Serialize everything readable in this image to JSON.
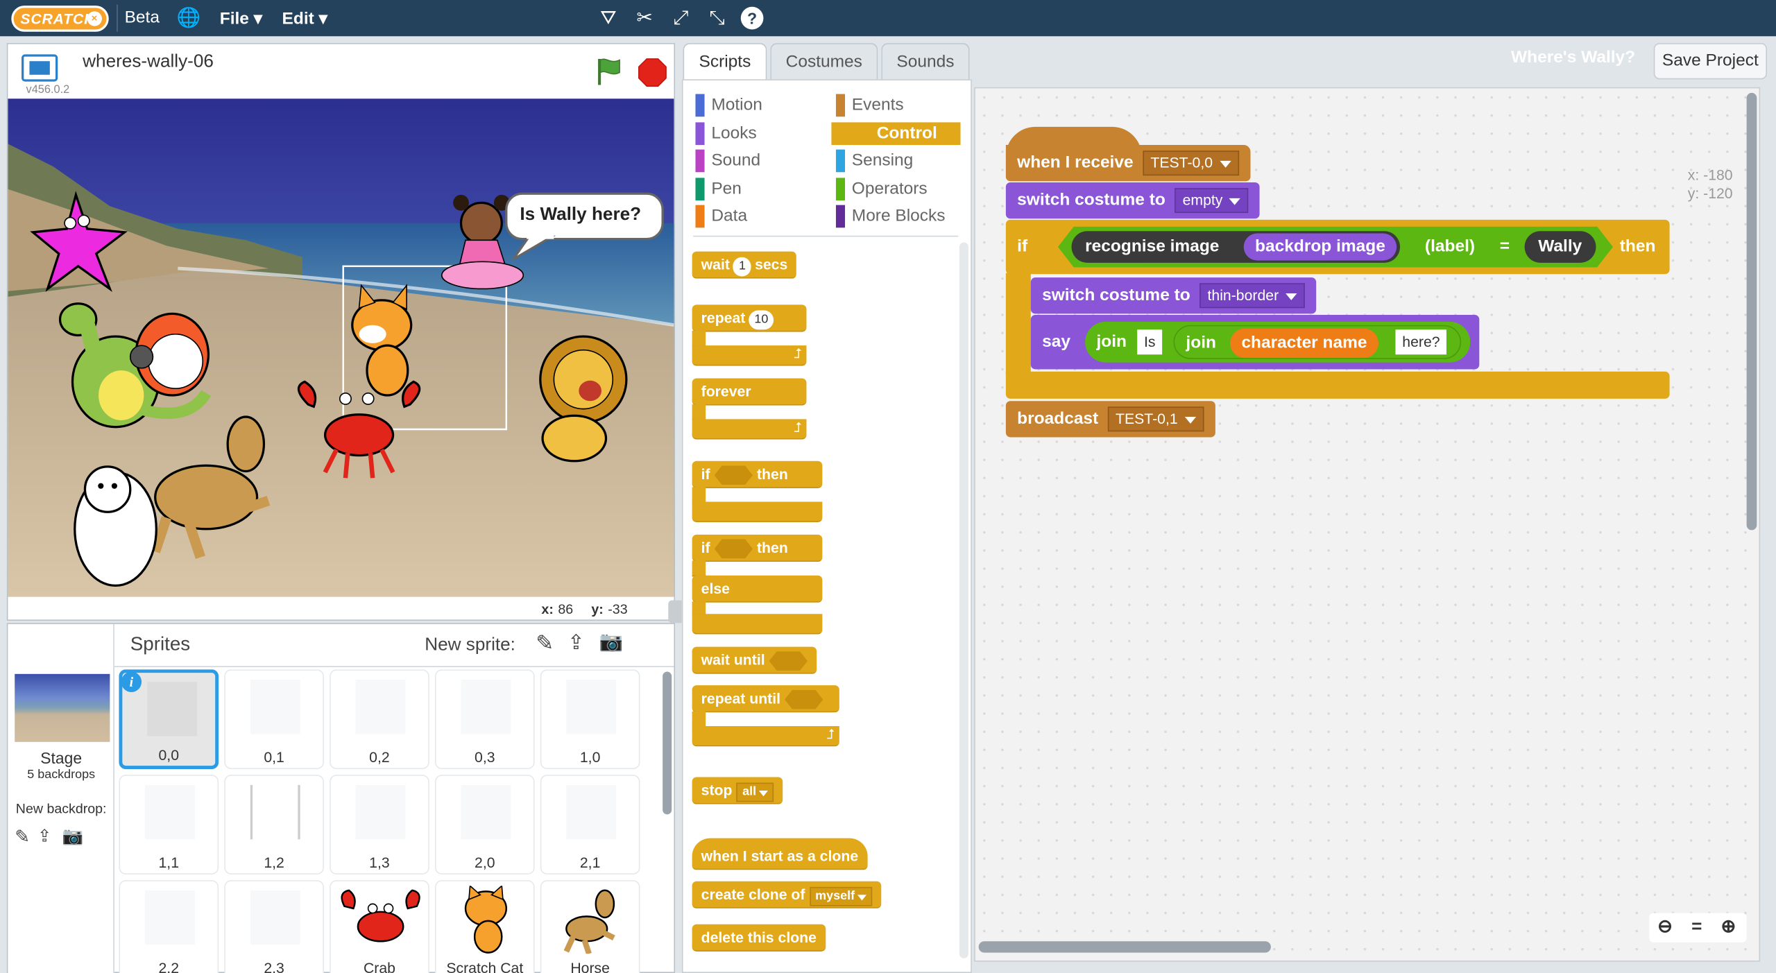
{
  "menubar": {
    "logo": "SCRATCH",
    "beta": "Beta",
    "file": "File",
    "edit": "Edit",
    "icons": [
      "duplicate-icon",
      "cut-icon",
      "grow-icon",
      "shrink-icon",
      "help-icon"
    ]
  },
  "stage": {
    "project_name": "wheres-wally-06",
    "version": "v456.0.2",
    "speech": "Is Wally here?",
    "mouse_x_label": "x:",
    "mouse_x": "86",
    "mouse_y_label": "y:",
    "mouse_y": "-33"
  },
  "sprites": {
    "header": "Sprites",
    "new_sprite": "New sprite:",
    "stage_label": "Stage",
    "backdrops": "5 backdrops",
    "new_backdrop": "New backdrop:",
    "items": [
      "0,0",
      "0,1",
      "0,2",
      "0,3",
      "1,0",
      "1,1",
      "1,2",
      "1,3",
      "2,0",
      "2,1",
      "2,2",
      "2,3",
      "Crab",
      "Scratch Cat",
      "Horse"
    ]
  },
  "tabs": [
    "Scripts",
    "Costumes",
    "Sounds"
  ],
  "project_title": "Where's Wally?",
  "save_project": "Save Project",
  "categories": {
    "left": [
      "Motion",
      "Looks",
      "Sound",
      "Pen",
      "Data"
    ],
    "right": [
      "Events",
      "Control",
      "Sensing",
      "Operators",
      "More Blocks"
    ],
    "colors": {
      "Motion": "#4a6cd4",
      "Looks": "#8a55d7",
      "Sound": "#bb42c3",
      "Pen": "#0e9a6c",
      "Data": "#ee7d16",
      "Events": "#c88330",
      "Control": "#e1a91a",
      "Sensing": "#2ca5e2",
      "Operators": "#5cb712",
      "More Blocks": "#632d99"
    },
    "selected": "Control"
  },
  "palette": {
    "wait": "wait",
    "wait_val": "1",
    "secs": "secs",
    "repeat": "repeat",
    "repeat_val": "10",
    "forever": "forever",
    "if": "if",
    "then": "then",
    "else": "else",
    "wait_until": "wait  until",
    "repeat_until": "repeat  until",
    "stop": "stop",
    "stop_val": "all",
    "start_clone": "when I start as a clone",
    "create_clone": "create clone of",
    "clone_val": "myself",
    "delete_clone": "delete this clone"
  },
  "script": {
    "when_receive": "when I receive",
    "receive_val": "TEST-0,0",
    "switch_costume": "switch costume to",
    "costume1": "empty",
    "if": "if",
    "recognise": "recognise image",
    "backdrop_image": "backdrop image",
    "label": "(label)",
    "equals": "=",
    "wally": "Wally",
    "then": "then",
    "costume2": "thin-border",
    "say": "say",
    "join": "join",
    "is_text": "Is",
    "character_name": "character name",
    "here_text": "here?",
    "broadcast": "broadcast",
    "broadcast_val": "TEST-0,1",
    "xy_x": "x: -180",
    "xy_y": "y: -120"
  }
}
